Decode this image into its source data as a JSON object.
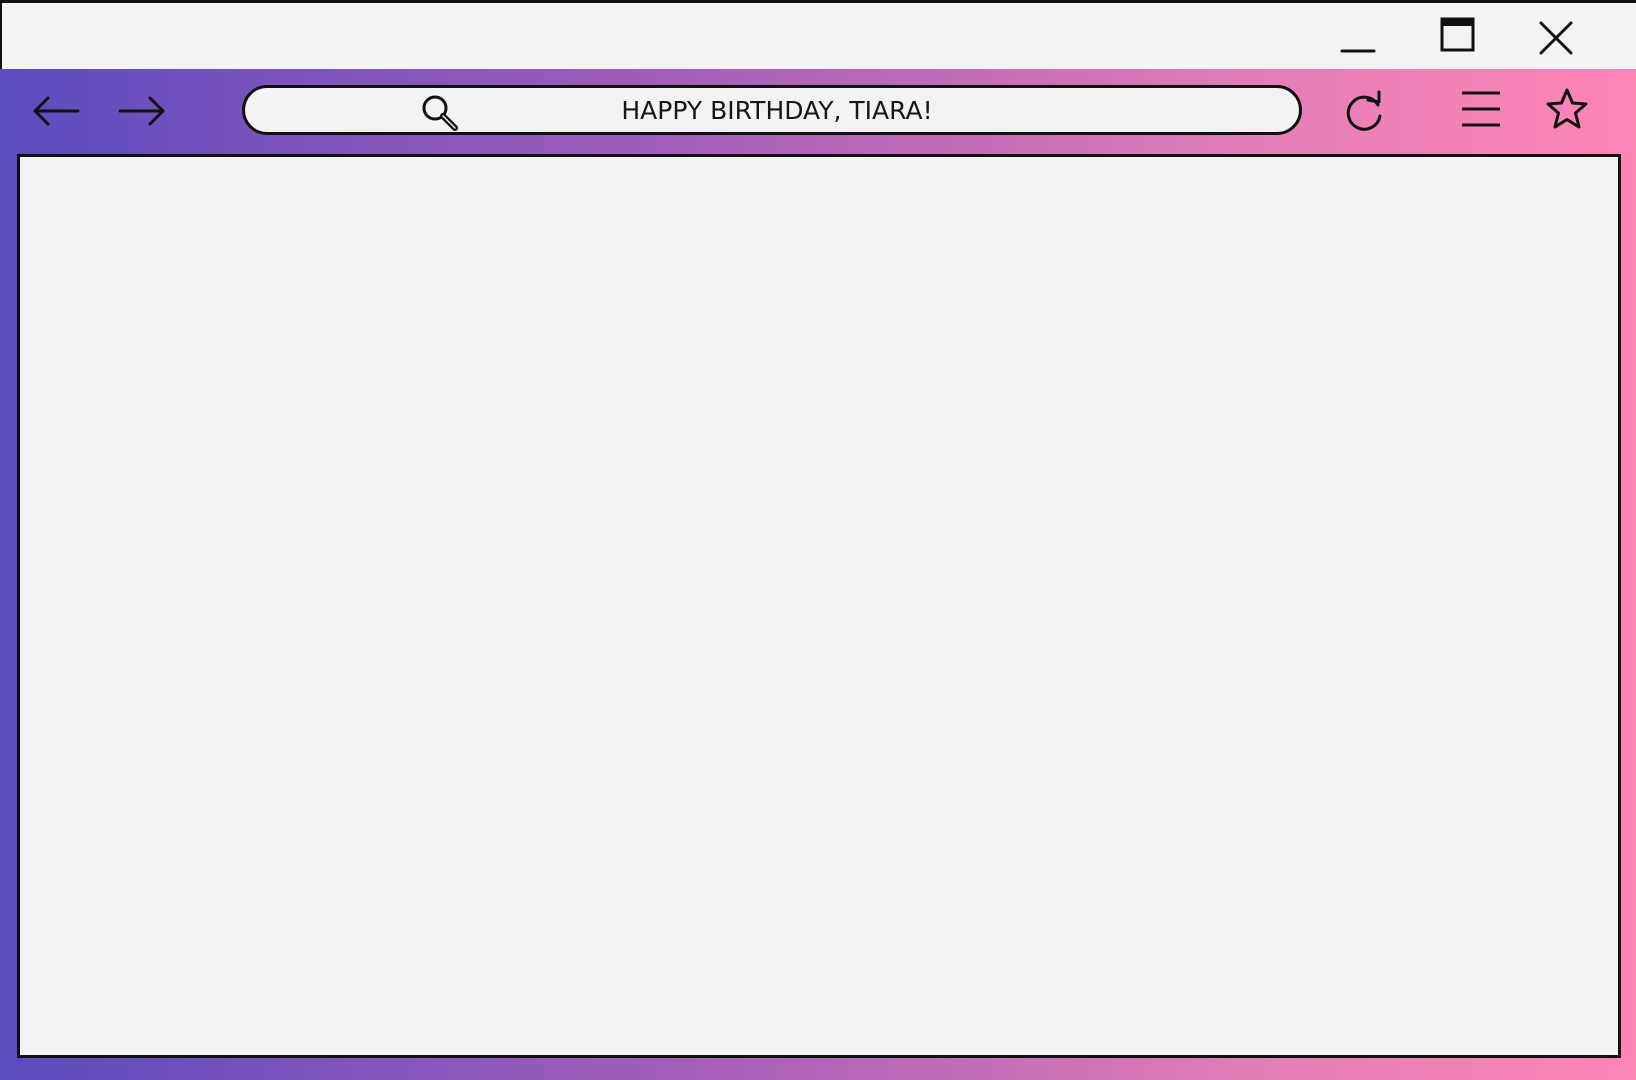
{
  "window": {
    "controls": {
      "minimize_icon": "minimize-icon",
      "maximize_icon": "maximize-icon",
      "close_icon": "close-icon"
    }
  },
  "toolbar": {
    "back_icon": "arrow-left-icon",
    "forward_icon": "arrow-right-icon",
    "refresh_icon": "refresh-icon",
    "menu_icon": "hamburger-menu-icon",
    "bookmark_icon": "star-icon"
  },
  "address_bar": {
    "search_icon": "search-icon",
    "text": "HAPPY BIRTHDAY, TIARA!"
  },
  "colors": {
    "gradient_start": "#5b4cbf",
    "gradient_end": "#ff85b5",
    "surface": "#f3f3f3",
    "outline": "#111111"
  }
}
